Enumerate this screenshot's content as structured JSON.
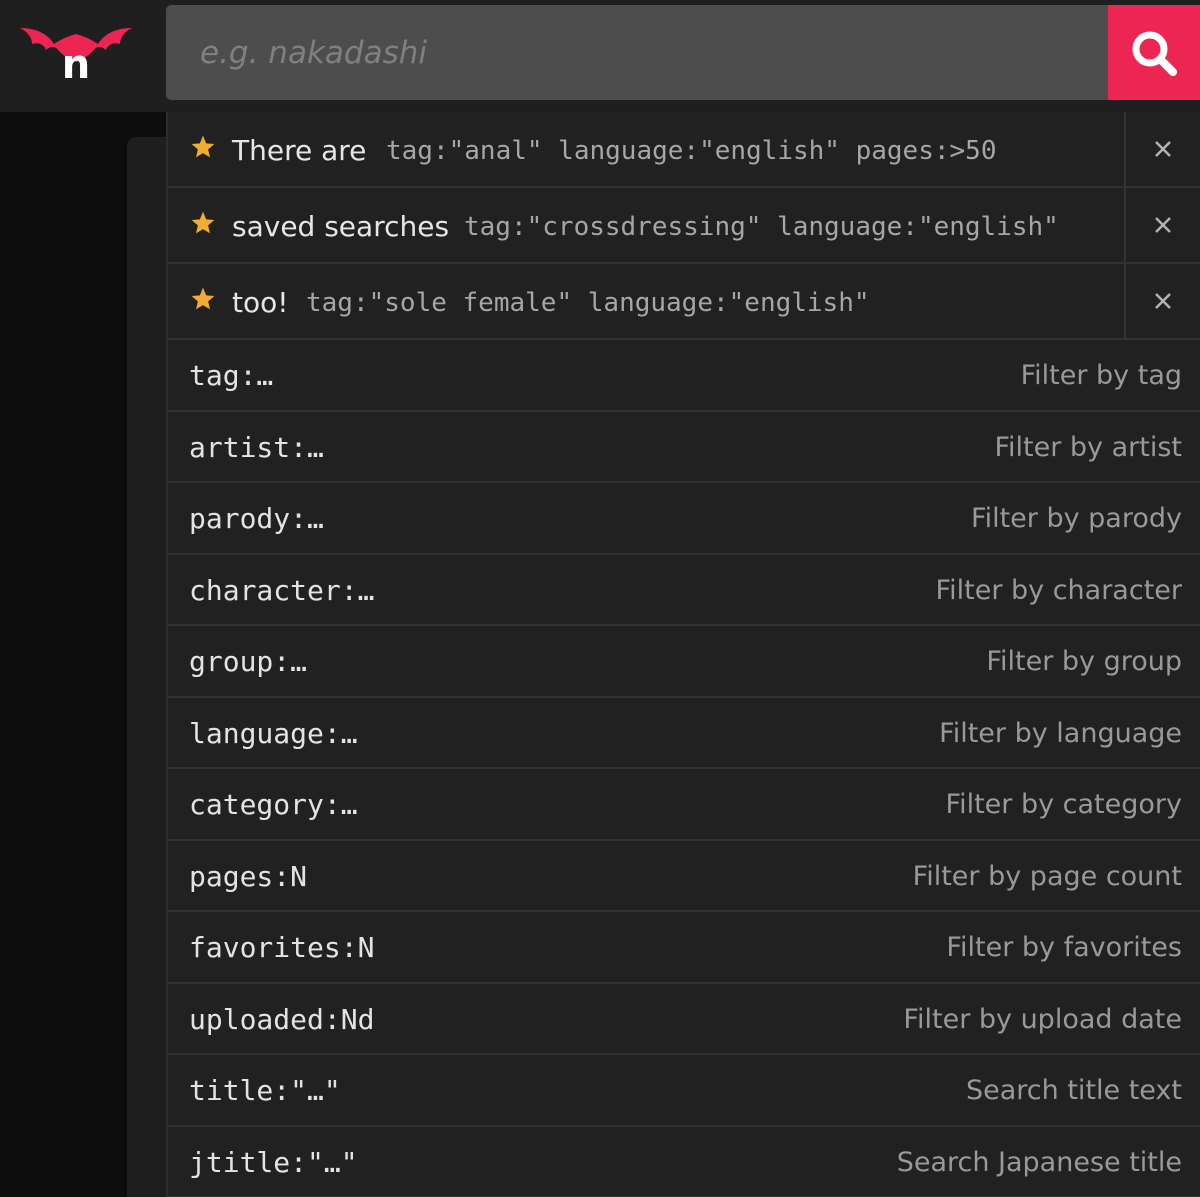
{
  "brand": {
    "logo_letter": "n",
    "accent_color": "#ed2553"
  },
  "search": {
    "placeholder": "e.g. nakadashi",
    "value": "",
    "button_icon": "search-icon"
  },
  "saved_searches": [
    {
      "label": "There are",
      "query": "tag:\"anal\" language:\"english\" pages:>50",
      "icon": "star-icon",
      "remove_icon": "close-icon"
    },
    {
      "label": "saved searches",
      "query": "tag:\"crossdressing\" language:\"english\"",
      "icon": "star-icon",
      "remove_icon": "close-icon"
    },
    {
      "label": "too!",
      "query": "tag:\"sole female\" language:\"english\"",
      "icon": "star-icon",
      "remove_icon": "close-icon"
    }
  ],
  "filters": [
    {
      "syntax": "tag:…",
      "description": "Filter by tag"
    },
    {
      "syntax": "artist:…",
      "description": "Filter by artist"
    },
    {
      "syntax": "parody:…",
      "description": "Filter by parody"
    },
    {
      "syntax": "character:…",
      "description": "Filter by character"
    },
    {
      "syntax": "group:…",
      "description": "Filter by group"
    },
    {
      "syntax": "language:…",
      "description": "Filter by language"
    },
    {
      "syntax": "category:…",
      "description": "Filter by category"
    },
    {
      "syntax": "pages:N",
      "description": "Filter by page count"
    },
    {
      "syntax": "favorites:N",
      "description": "Filter by favorites"
    },
    {
      "syntax": "uploaded:Nd",
      "description": "Filter by upload date"
    },
    {
      "syntax": "title:\"…\"",
      "description": "Search title text"
    },
    {
      "syntax": "jtitle:\"…\"",
      "description": "Search Japanese title"
    }
  ]
}
